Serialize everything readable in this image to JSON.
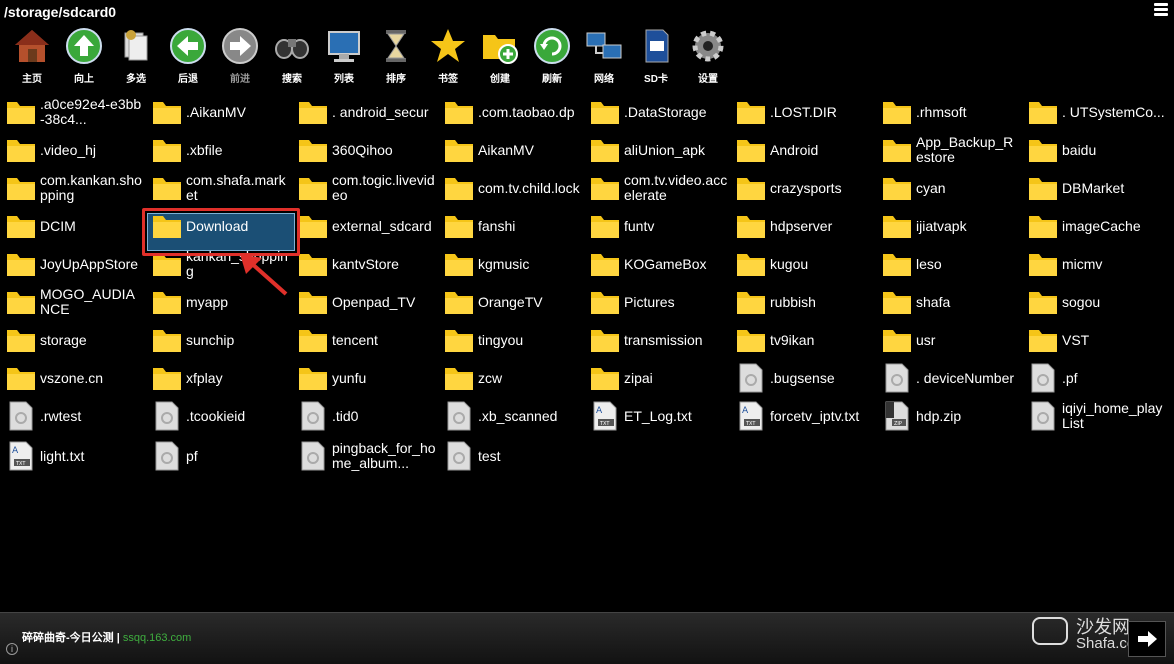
{
  "path": "/storage/sdcard0",
  "toolbar": [
    {
      "label": "主页",
      "icon": "home-icon",
      "enabled": true
    },
    {
      "label": "向上",
      "icon": "up-arrow-icon",
      "enabled": true
    },
    {
      "label": "多选",
      "icon": "multi-select-icon",
      "enabled": true
    },
    {
      "label": "后退",
      "icon": "back-arrow-icon",
      "enabled": true
    },
    {
      "label": "前进",
      "icon": "forward-arrow-icon",
      "enabled": false
    },
    {
      "label": "搜索",
      "icon": "binoculars-icon",
      "enabled": true
    },
    {
      "label": "列表",
      "icon": "monitor-list-icon",
      "enabled": true
    },
    {
      "label": "排序",
      "icon": "hourglass-icon",
      "enabled": true
    },
    {
      "label": "书签",
      "icon": "star-icon",
      "enabled": true
    },
    {
      "label": "创建",
      "icon": "new-folder-icon",
      "enabled": true
    },
    {
      "label": "刷新",
      "icon": "refresh-icon",
      "enabled": true
    },
    {
      "label": "网络",
      "icon": "network-icon",
      "enabled": true
    },
    {
      "label": "SD卡",
      "icon": "sd-card-icon",
      "enabled": true
    },
    {
      "label": "设置",
      "icon": "settings-icon",
      "enabled": true
    }
  ],
  "files": [
    {
      "name": ".a0ce92e4-e3bb-38c4...",
      "type": "folder"
    },
    {
      "name": ".AikanMV",
      "type": "folder"
    },
    {
      "name": ". android_secur",
      "type": "folder"
    },
    {
      "name": ".com.taobao.dp",
      "type": "folder"
    },
    {
      "name": ".DataStorage",
      "type": "folder"
    },
    {
      "name": ".LOST.DIR",
      "type": "folder"
    },
    {
      "name": ".rhmsoft",
      "type": "folder"
    },
    {
      "name": ". UTSystemCo...",
      "type": "folder"
    },
    {
      "name": ".video_hj",
      "type": "folder"
    },
    {
      "name": ".xbfile",
      "type": "folder"
    },
    {
      "name": "360Qihoo",
      "type": "folder"
    },
    {
      "name": "AikanMV",
      "type": "folder"
    },
    {
      "name": "aliUnion_apk",
      "type": "folder"
    },
    {
      "name": "Android",
      "type": "folder"
    },
    {
      "name": "App_Backup_Restore",
      "type": "folder"
    },
    {
      "name": "baidu",
      "type": "folder"
    },
    {
      "name": "com.kankan.shopping",
      "type": "folder"
    },
    {
      "name": "com.shafa.market",
      "type": "folder"
    },
    {
      "name": "com.togic.livevideo",
      "type": "folder"
    },
    {
      "name": "com.tv.child.lock",
      "type": "folder"
    },
    {
      "name": "com.tv.video.accelerate",
      "type": "folder"
    },
    {
      "name": "crazysports",
      "type": "folder"
    },
    {
      "name": "cyan",
      "type": "folder"
    },
    {
      "name": "DBMarket",
      "type": "folder"
    },
    {
      "name": "DCIM",
      "type": "folder"
    },
    {
      "name": "Download",
      "type": "folder"
    },
    {
      "name": "external_sdcard",
      "type": "folder"
    },
    {
      "name": "fanshi",
      "type": "folder"
    },
    {
      "name": "funtv",
      "type": "folder"
    },
    {
      "name": "hdpserver",
      "type": "folder"
    },
    {
      "name": "ijiatvapk",
      "type": "folder"
    },
    {
      "name": "imageCache",
      "type": "folder"
    },
    {
      "name": "JoyUpAppStore",
      "type": "folder"
    },
    {
      "name": "kankan_shopping",
      "type": "folder"
    },
    {
      "name": "kantvStore",
      "type": "folder"
    },
    {
      "name": "kgmusic",
      "type": "folder"
    },
    {
      "name": "KOGameBox",
      "type": "folder"
    },
    {
      "name": "kugou",
      "type": "folder"
    },
    {
      "name": "leso",
      "type": "folder"
    },
    {
      "name": "micmv",
      "type": "folder"
    },
    {
      "name": "MOGO_AUDIANCE",
      "type": "folder"
    },
    {
      "name": "myapp",
      "type": "folder"
    },
    {
      "name": "Openpad_TV",
      "type": "folder"
    },
    {
      "name": "OrangeTV",
      "type": "folder"
    },
    {
      "name": "Pictures",
      "type": "folder"
    },
    {
      "name": "rubbish",
      "type": "folder"
    },
    {
      "name": "shafa",
      "type": "folder"
    },
    {
      "name": "sogou",
      "type": "folder"
    },
    {
      "name": "storage",
      "type": "folder"
    },
    {
      "name": "sunchip",
      "type": "folder"
    },
    {
      "name": "tencent",
      "type": "folder"
    },
    {
      "name": "tingyou",
      "type": "folder"
    },
    {
      "name": "transmission",
      "type": "folder"
    },
    {
      "name": "tv9ikan",
      "type": "folder"
    },
    {
      "name": "usr",
      "type": "folder"
    },
    {
      "name": "VST",
      "type": "folder"
    },
    {
      "name": "vszone.cn",
      "type": "folder"
    },
    {
      "name": "xfplay",
      "type": "folder"
    },
    {
      "name": "yunfu",
      "type": "folder"
    },
    {
      "name": "zcw",
      "type": "folder"
    },
    {
      "name": "zipai",
      "type": "folder"
    },
    {
      "name": ".bugsense",
      "type": "file"
    },
    {
      "name": ". deviceNumber",
      "type": "file"
    },
    {
      "name": ".pf",
      "type": "file"
    },
    {
      "name": ".rwtest",
      "type": "file"
    },
    {
      "name": ".tcookieid",
      "type": "file"
    },
    {
      "name": ".tid0",
      "type": "file"
    },
    {
      "name": ".xb_scanned",
      "type": "file"
    },
    {
      "name": "ET_Log.txt",
      "type": "txt"
    },
    {
      "name": "forcetv_iptv.txt",
      "type": "txt"
    },
    {
      "name": "hdp.zip",
      "type": "zip"
    },
    {
      "name": "iqiyi_home_playList",
      "type": "file"
    },
    {
      "name": "light.txt",
      "type": "txt"
    },
    {
      "name": "pf",
      "type": "file"
    },
    {
      "name": "pingback_for_home_album...",
      "type": "file"
    },
    {
      "name": "test",
      "type": "file"
    }
  ],
  "selected_file": "Download",
  "bottom": {
    "ad_text": "碎碎曲奇-今日公测 | ",
    "ad_url": "ssqq.163.com",
    "watermark_line1": "沙发网",
    "watermark_line2": "Shafa.com"
  },
  "colors": {
    "folder": "#f5c518",
    "selection_border": "#e0302a",
    "selection_fill": "#1b4f75",
    "ad_url": "#3fae3f"
  }
}
